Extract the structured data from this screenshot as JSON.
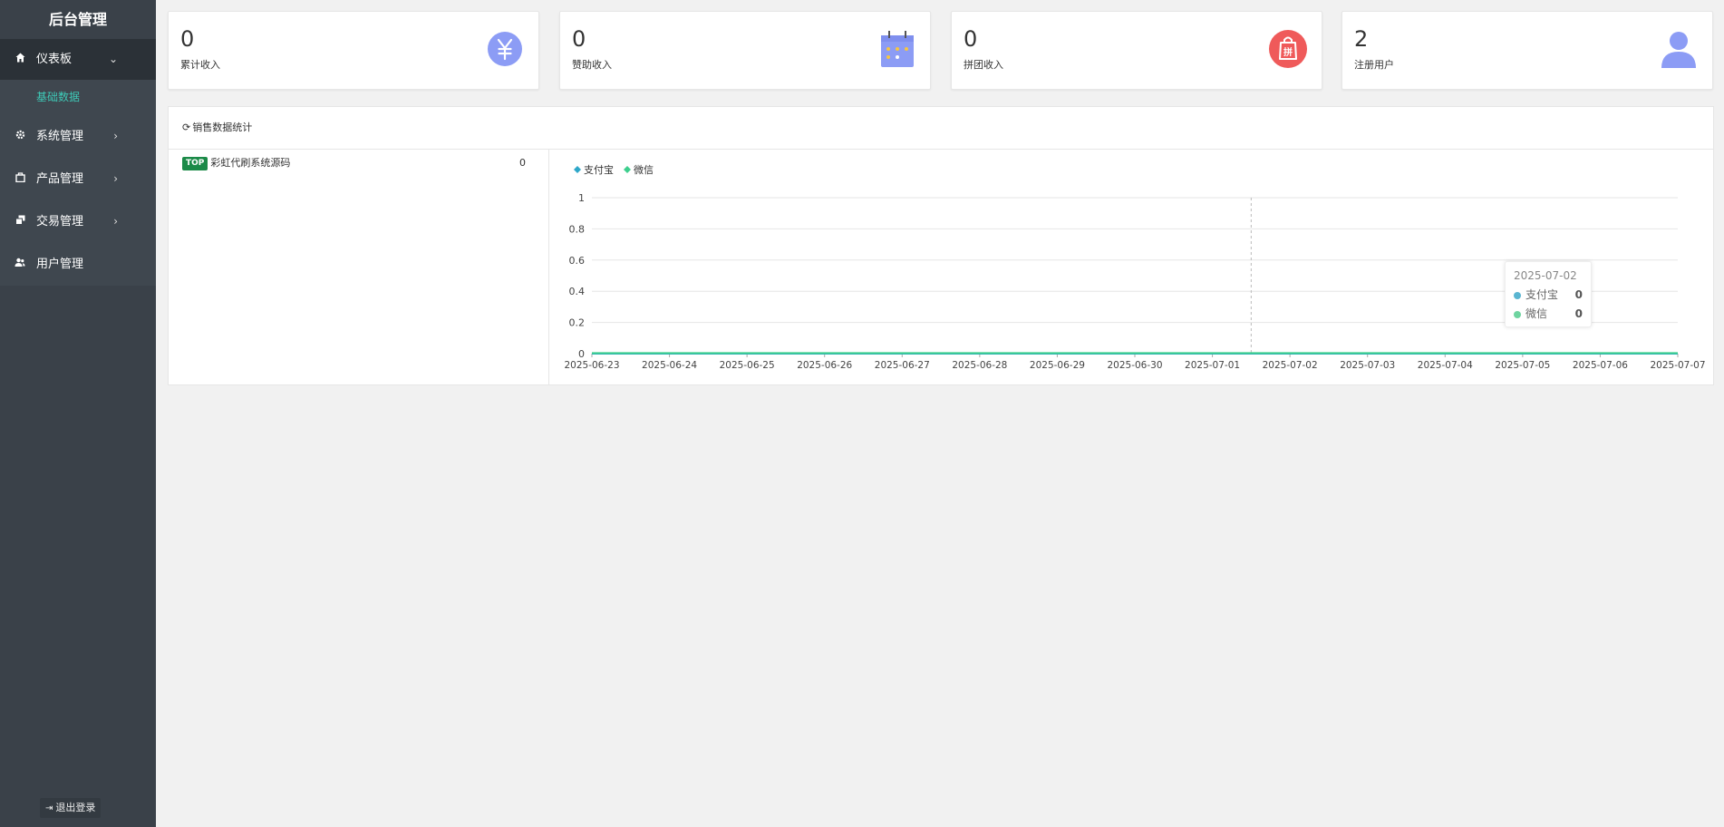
{
  "sidebar": {
    "brand": "后台管理",
    "items": [
      {
        "label": "仪表板",
        "icon": "home-icon"
      },
      {
        "label": "系统管理",
        "icon": "gear-icon"
      },
      {
        "label": "产品管理",
        "icon": "product-icon"
      },
      {
        "label": "交易管理",
        "icon": "transaction-icon"
      },
      {
        "label": "用户管理",
        "icon": "users-icon"
      }
    ],
    "submenu": {
      "label": "基础数据"
    },
    "logout": "退出登录"
  },
  "cards": [
    {
      "value": "0",
      "label": "累计收入",
      "icon": "yuan-icon",
      "color": "#8c9cf5"
    },
    {
      "value": "0",
      "label": "赞助收入",
      "icon": "calendar-icon",
      "color": "#8c9cf5"
    },
    {
      "value": "0",
      "label": "拼团收入",
      "icon": "group-buy-bag-icon",
      "color": "#ef5a5a"
    },
    {
      "value": "2",
      "label": "注册用户",
      "icon": "user-icon",
      "color": "#8c9cf5"
    }
  ],
  "sales": {
    "title": "销售数据统计",
    "ranking": [
      {
        "badge": "TOP",
        "name": "彩虹代刷系统源码",
        "value": "0"
      }
    ]
  },
  "chart_data": {
    "type": "line",
    "x": [
      "2025-06-23",
      "2025-06-24",
      "2025-06-25",
      "2025-06-26",
      "2025-06-27",
      "2025-06-28",
      "2025-06-29",
      "2025-06-30",
      "2025-07-01",
      "2025-07-02",
      "2025-07-03",
      "2025-07-04",
      "2025-07-05",
      "2025-07-06",
      "2025-07-07"
    ],
    "series": [
      {
        "name": "支付宝",
        "color": "#2ea7c9",
        "values": [
          0,
          0,
          0,
          0,
          0,
          0,
          0,
          0,
          0,
          0,
          0,
          0,
          0,
          0,
          0
        ]
      },
      {
        "name": "微信",
        "color": "#3ecf8e",
        "values": [
          0,
          0,
          0,
          0,
          0,
          0,
          0,
          0,
          0,
          0,
          0,
          0,
          0,
          0,
          0
        ]
      }
    ],
    "ylim": [
      0,
      1
    ],
    "yticks": [
      "0",
      "0.2",
      "0.4",
      "0.6",
      "0.8",
      "1"
    ],
    "grid": true,
    "legend": "top-left",
    "tooltip": {
      "title": "2025-07-02",
      "rows": [
        {
          "name": "支付宝",
          "value": "0",
          "color": "#5ab5d1"
        },
        {
          "name": "微信",
          "value": "0",
          "color": "#6fd4a0"
        }
      ]
    }
  }
}
